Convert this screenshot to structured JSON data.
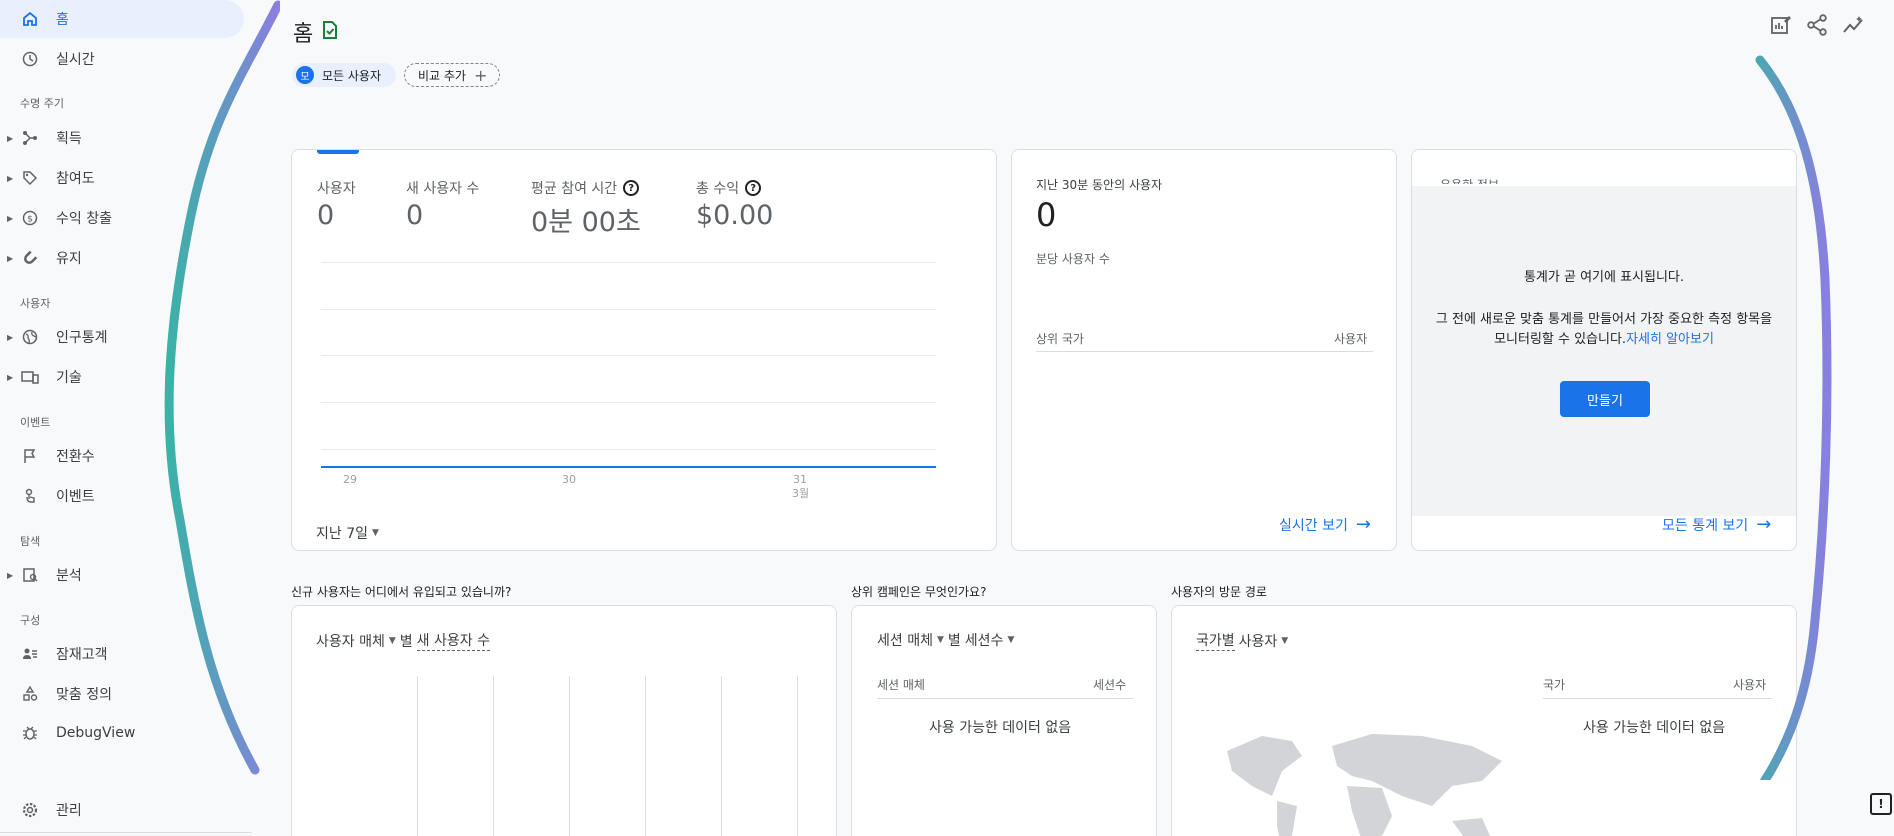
{
  "sidebar": {
    "home": "홈",
    "realtime": "실시간",
    "lifecycle_label": "수명 주기",
    "acquisition": "획득",
    "engagement": "참여도",
    "monetization": "수익 창출",
    "retention": "유지",
    "user_label": "사용자",
    "demographics": "인구통계",
    "tech": "기술",
    "events_label": "이벤트",
    "conversions": "전환수",
    "events": "이벤트",
    "explore_label": "탐색",
    "analysis": "분석",
    "configure_label": "구성",
    "audiences": "잠재고객",
    "custom_definitions": "맞춤 정의",
    "debugview": "DebugView",
    "admin": "관리"
  },
  "header": {
    "title": "홈",
    "segment_avatar": "모",
    "segment_label": "모든 사용자",
    "add_comparison": "비교 추가"
  },
  "overview": {
    "kpis": [
      {
        "label": "사용자",
        "value": "0"
      },
      {
        "label": "새 사용자 수",
        "value": "0"
      },
      {
        "label": "평균 참여 시간",
        "value": "0분 00초"
      },
      {
        "label": "총 수익",
        "value": "$0.00"
      }
    ],
    "x_ticks": [
      "29",
      "30",
      "31"
    ],
    "month_label": "3월",
    "date_range": "지난 7일"
  },
  "realtime_card": {
    "title": "지난 30분 동안의 사용자",
    "value": "0",
    "subtitle": "분당 사용자 수",
    "col_country": "상위 국가",
    "col_users": "사용자",
    "link": "실시간 보기"
  },
  "insights_card": {
    "title": "유용한 정보",
    "heading": "통계가 곧 여기에 표시됩니다.",
    "body": "그 전에 새로운 맞춤 통계를 만들어서 가장 중요한 측정 항목을 모니터링할 수 있습니다.",
    "learn_more": "자세히 알아보기",
    "create_button": "만들기",
    "link": "모든 통계 보기"
  },
  "acquisition_section": {
    "title": "신규 사용자는 어디에서 유입되고 있습니까?",
    "dimension": "사용자 매체",
    "by": "별",
    "metric": "새 사용자 수"
  },
  "campaign_section": {
    "title": "상위 캠페인은 무엇인가요?",
    "dimension": "세션 매체",
    "by": "별",
    "metric": "세션수",
    "col_dimension": "세션 매체",
    "col_metric": "세션수",
    "no_data": "사용 가능한 데이터 없음"
  },
  "geo_section": {
    "title": "사용자의 방문 경로",
    "dimension": "국가별",
    "metric": "사용자",
    "col_country": "국가",
    "col_users": "사용자",
    "no_data": "사용 가능한 데이터 없음"
  },
  "colors": {
    "accent": "#1a73e8",
    "active_nav_bg": "#e8f0fe",
    "background": "#f8f9fa",
    "card_border": "#dadce0"
  },
  "icons": [
    "home-icon",
    "clock-icon",
    "acquisition-icon",
    "tag-icon",
    "dollar-icon",
    "magnet-icon",
    "globe-icon",
    "devices-icon",
    "flag-icon",
    "touch-icon",
    "explore-icon",
    "audience-icon",
    "shapes-icon",
    "bug-icon",
    "gear-icon",
    "edit-report-icon",
    "share-icon",
    "insights-icon",
    "feedback-icon"
  ]
}
